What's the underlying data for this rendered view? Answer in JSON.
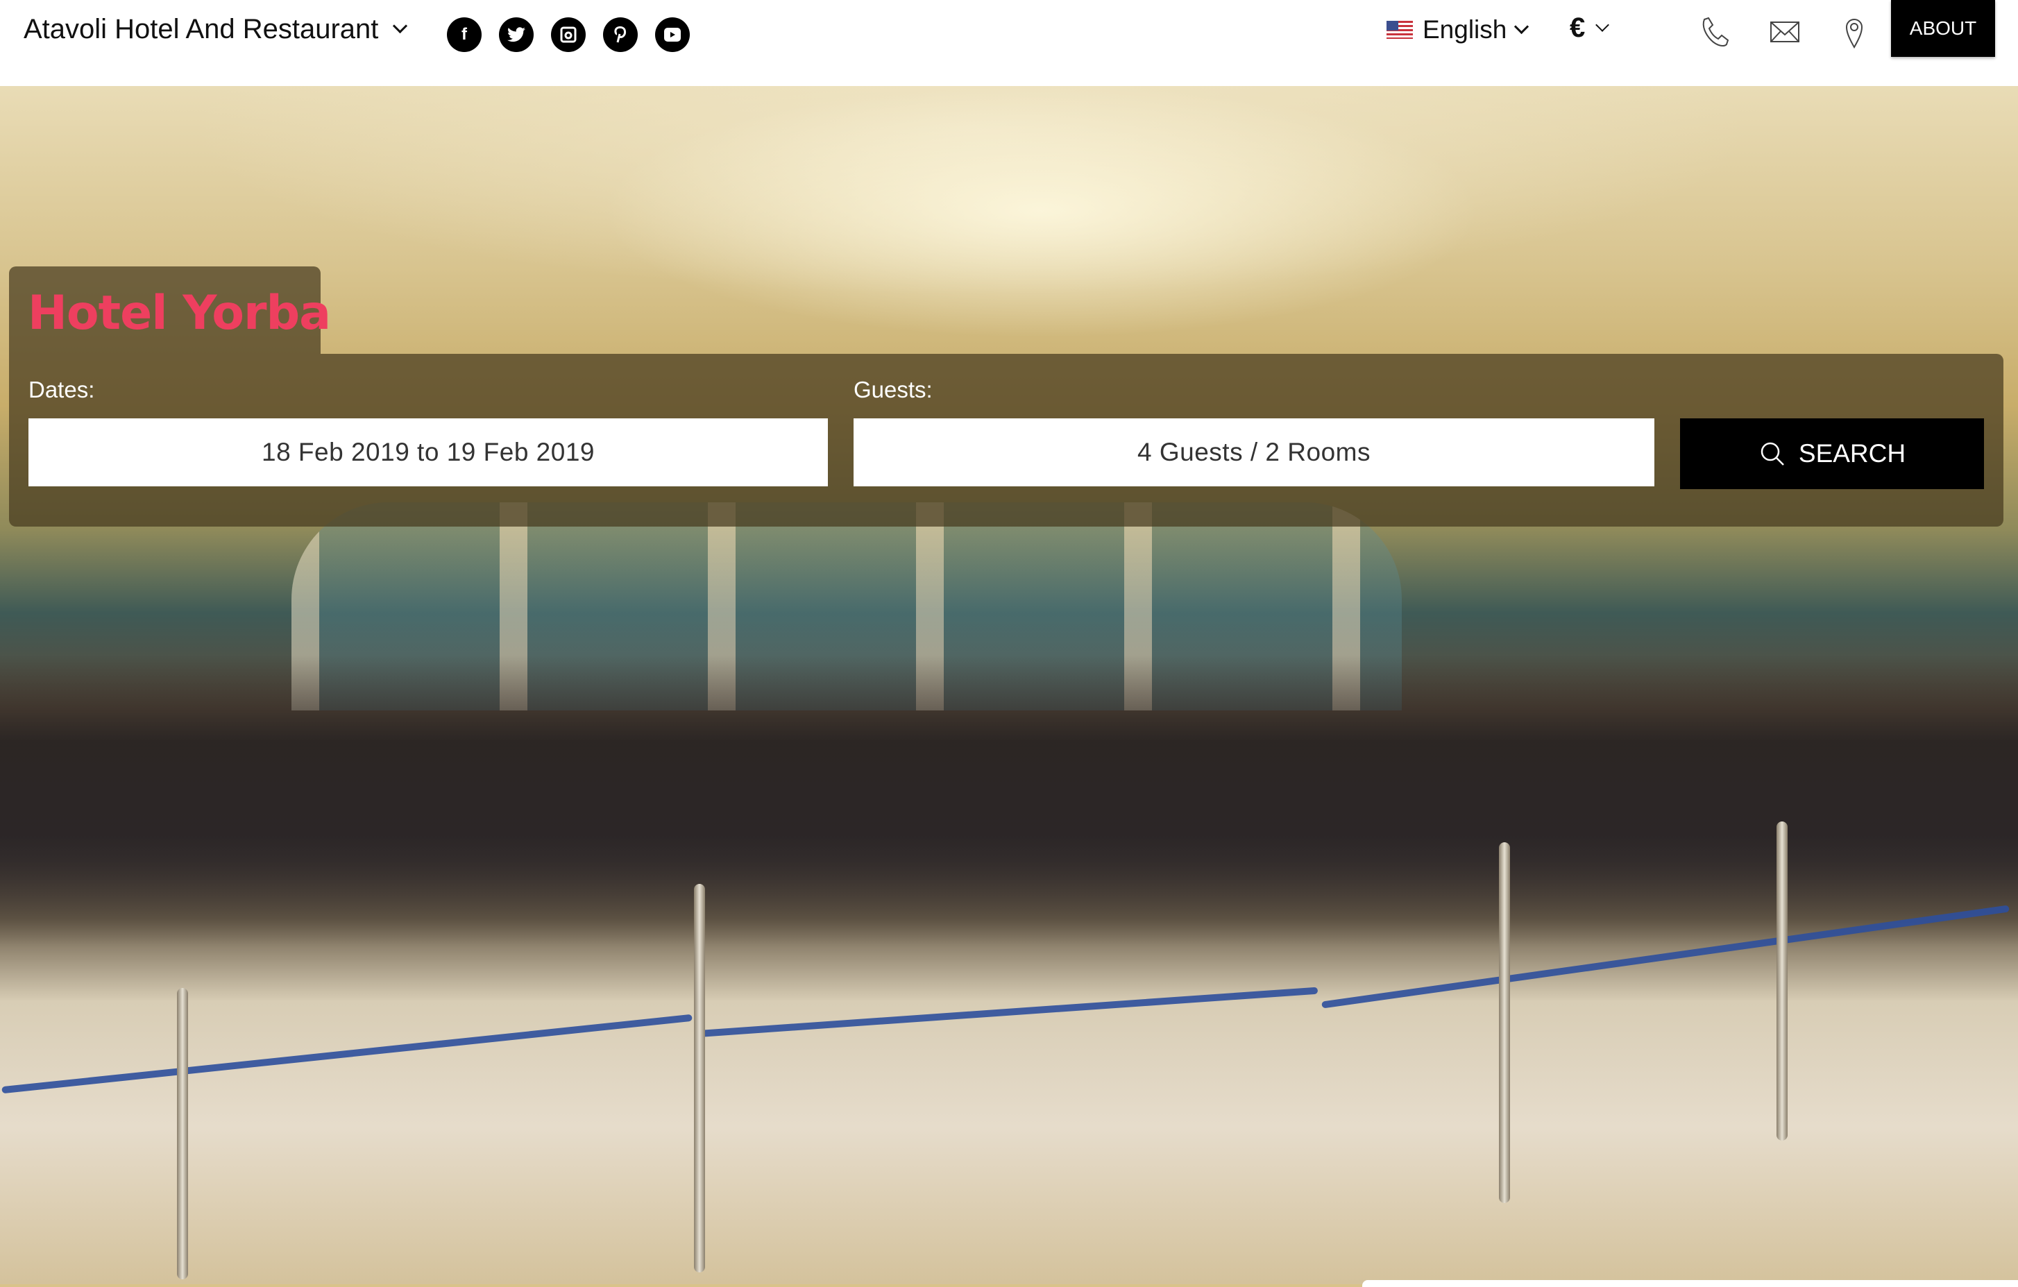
{
  "header": {
    "brand": "Atavoli Hotel And Restaurant",
    "social": [
      {
        "name": "facebook",
        "glyph": "f"
      },
      {
        "name": "twitter",
        "glyph": "t"
      },
      {
        "name": "instagram",
        "glyph": "◘"
      },
      {
        "name": "pinterest",
        "glyph": "p"
      },
      {
        "name": "youtube",
        "glyph": "▶"
      }
    ],
    "language": "English",
    "currency": "€",
    "about_label": "ABOUT",
    "icons": [
      "phone-icon",
      "mail-icon",
      "location-pin-icon"
    ]
  },
  "booking": {
    "hotel_name": "Hotel Yorba",
    "dates_label": "Dates:",
    "dates_value": "18 Feb 2019 to 19 Feb 2019",
    "guests_label": "Guests:",
    "guests_value": "4 Guests / 2 Rooms",
    "search_label": "SEARCH"
  },
  "colors": {
    "title": "#ee3f5f",
    "button": "#000000"
  }
}
